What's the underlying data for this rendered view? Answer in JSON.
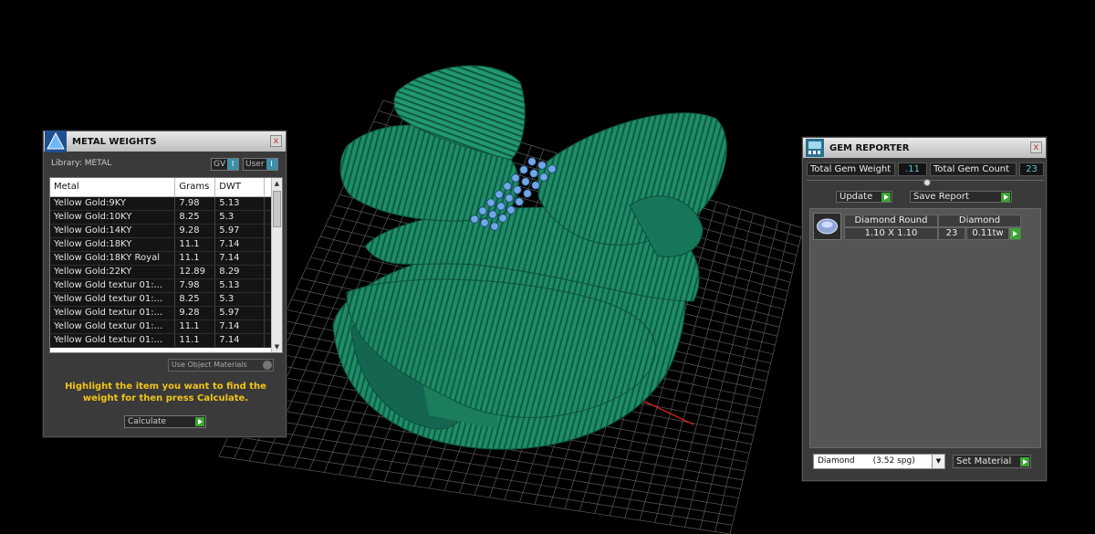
{
  "metal_weights": {
    "title": "METAL WEIGHTS",
    "close": "x",
    "library_label": "Library: METAL",
    "toggle_gv": "GV",
    "toggle_user": "User",
    "toggle_mark": "I",
    "columns": [
      "Metal",
      "Grams",
      "DWT"
    ],
    "rows": [
      [
        "Yellow Gold:9KY",
        "7.98",
        "5.13"
      ],
      [
        "Yellow Gold:10KY",
        "8.25",
        "5.3"
      ],
      [
        "Yellow Gold:14KY",
        "9.28",
        "5.97"
      ],
      [
        "Yellow Gold:18KY",
        "11.1",
        "7.14"
      ],
      [
        "Yellow Gold:18KY Royal",
        "11.1",
        "7.14"
      ],
      [
        "Yellow Gold:22KY",
        "12.89",
        "8.29"
      ],
      [
        "Yellow Gold textur 01:...",
        "7.98",
        "5.13"
      ],
      [
        "Yellow Gold textur 01:...",
        "8.25",
        "5.3"
      ],
      [
        "Yellow Gold textur 01:...",
        "9.28",
        "5.97"
      ],
      [
        "Yellow Gold textur 01:...",
        "11.1",
        "7.14"
      ],
      [
        "Yellow Gold textur 01:...",
        "11.1",
        "7.14"
      ]
    ],
    "use_object_materials": "Use Object Materials",
    "hint": "Highlight the item you want to find the weight for then press Calculate.",
    "calculate": "Calculate"
  },
  "gem_reporter": {
    "title": "GEM REPORTER",
    "close": "x",
    "total_weight_label": "Total Gem Weight",
    "total_weight_value": ".11",
    "total_count_label": "Total Gem Count",
    "total_count_value": "23",
    "update": "Update",
    "save_report": "Save Report",
    "gem": {
      "name": "Diamond Round",
      "material": "Diamond",
      "size": "1.10 X 1.10",
      "count": "23",
      "weight": "0.11tw"
    },
    "material_select": "Diamond       (3.52 spg)",
    "set_material": "Set Material"
  },
  "colors": {
    "model_green": "#1f8f6a",
    "gem_blue": "#6fa8e8",
    "accent_yellow": "#f0c419",
    "value_cyan": "#5ec7e0",
    "go_green": "#3ca532"
  }
}
